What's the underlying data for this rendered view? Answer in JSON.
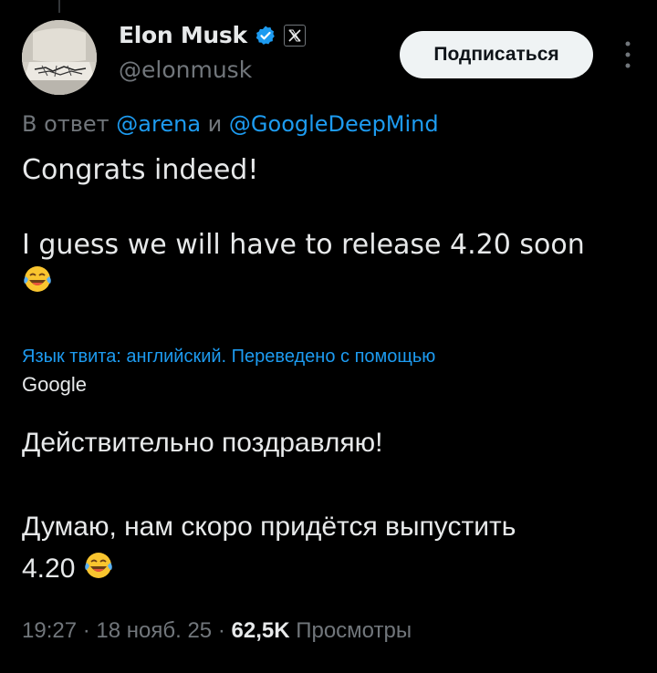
{
  "author": {
    "display_name": "Elon Musk",
    "handle": "@elonmusk",
    "verified_color": "#1d9bf0",
    "affiliate_badge": "x-logo-icon"
  },
  "actions": {
    "subscribe_label": "Подписаться",
    "more_icon": "more-vertical-icon"
  },
  "reply": {
    "prefix": "В ответ",
    "mention_1": "@arena",
    "conjunction": "и",
    "mention_2": "@GoogleDeepMind"
  },
  "tweet": {
    "line_1": "Congrats indeed!",
    "line_2": "I guess we will have to release 4.20 soon",
    "emoji": "face-with-tears-of-joy-icon"
  },
  "translation": {
    "note": "Язык твита: английский. Переведено с помощью",
    "provider": "Google",
    "line_1": "Действительно поздравляю!",
    "line_2": "Думаю, нам скоро придётся выпустить",
    "line_3": "4.20"
  },
  "meta": {
    "time": "19:27",
    "date": "18 нояб. 25",
    "views_count": "62,5K",
    "views_label": "Просмотры"
  },
  "colors": {
    "background": "#000000",
    "text": "#e7e9ea",
    "secondary": "#71767b",
    "link": "#1d9bf0"
  }
}
